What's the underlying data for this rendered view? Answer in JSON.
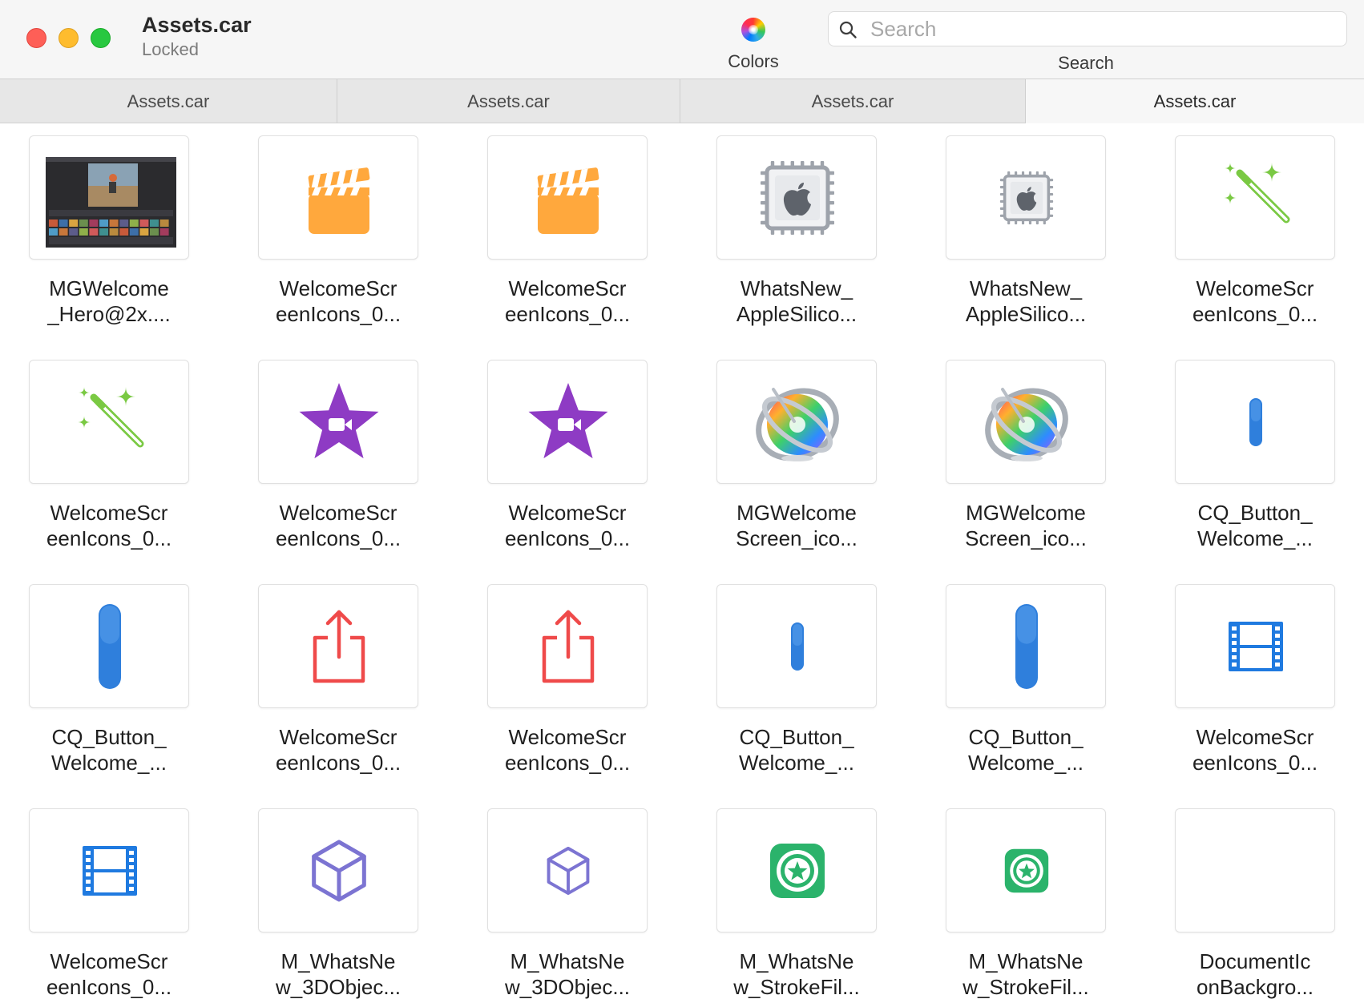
{
  "window": {
    "title": "Assets.car",
    "subtitle": "Locked"
  },
  "toolbar": {
    "colors_label": "Colors",
    "search_placeholder": "Search",
    "search_label": "Search"
  },
  "tabs": [
    {
      "label": "Assets.car",
      "active": false
    },
    {
      "label": "Assets.car",
      "active": false
    },
    {
      "label": "Assets.car",
      "active": false
    },
    {
      "label": "Assets.car",
      "active": true
    }
  ],
  "assets": [
    {
      "line1": "MGWelcome",
      "line2": "_Hero@2x....",
      "icon": "hero-screenshot-icon"
    },
    {
      "line1": "WelcomeScr",
      "line2": "eenIcons_0...",
      "icon": "clapperboard-icon"
    },
    {
      "line1": "WelcomeScr",
      "line2": "eenIcons_0...",
      "icon": "clapperboard-icon"
    },
    {
      "line1": "WhatsNew_",
      "line2": "AppleSilico...",
      "icon": "apple-silicon-chip-icon"
    },
    {
      "line1": "WhatsNew_",
      "line2": "AppleSilico...",
      "icon": "apple-silicon-chip-small-icon"
    },
    {
      "line1": "WelcomeScr",
      "line2": "eenIcons_0...",
      "icon": "magic-wand-icon"
    },
    {
      "line1": "WelcomeScr",
      "line2": "eenIcons_0...",
      "icon": "magic-wand-icon"
    },
    {
      "line1": "WelcomeScr",
      "line2": "eenIcons_0...",
      "icon": "imovie-star-icon"
    },
    {
      "line1": "WelcomeScr",
      "line2": "eenIcons_0...",
      "icon": "imovie-star-icon"
    },
    {
      "line1": "MGWelcome",
      "line2": "Screen_ico...",
      "icon": "motion-color-wheel-icon"
    },
    {
      "line1": "MGWelcome",
      "line2": "Screen_ico...",
      "icon": "motion-color-wheel-icon"
    },
    {
      "line1": "CQ_Button_",
      "line2": "Welcome_...",
      "icon": "blue-button-small-icon"
    },
    {
      "line1": "CQ_Button_",
      "line2": "Welcome_...",
      "icon": "blue-button-tall-icon"
    },
    {
      "line1": "WelcomeScr",
      "line2": "eenIcons_0...",
      "icon": "share-icon"
    },
    {
      "line1": "WelcomeScr",
      "line2": "eenIcons_0...",
      "icon": "share-icon"
    },
    {
      "line1": "CQ_Button_",
      "line2": "Welcome_...",
      "icon": "blue-button-small-icon"
    },
    {
      "line1": "CQ_Button_",
      "line2": "Welcome_...",
      "icon": "blue-button-tall-icon"
    },
    {
      "line1": "WelcomeScr",
      "line2": "eenIcons_0...",
      "icon": "film-strip-icon"
    },
    {
      "line1": "WelcomeScr",
      "line2": "eenIcons_0...",
      "icon": "film-strip-icon"
    },
    {
      "line1": "M_WhatsNe",
      "line2": "w_3DObjec...",
      "icon": "3d-cube-icon"
    },
    {
      "line1": "M_WhatsNe",
      "line2": "w_3DObjec...",
      "icon": "3d-cube-small-icon"
    },
    {
      "line1": "M_WhatsNe",
      "line2": "w_StrokeFil...",
      "icon": "stroke-filter-star-icon"
    },
    {
      "line1": "M_WhatsNe",
      "line2": "w_StrokeFil...",
      "icon": "stroke-filter-star-small-icon"
    },
    {
      "line1": "DocumentIc",
      "line2": "onBackgro...",
      "icon": "blank-document-icon"
    }
  ],
  "colors": {
    "clapper": "#ffa83d",
    "chip": "#9ea3ab",
    "wand": "#7ac943",
    "star": "#8e3bc4",
    "button_blue": "#2f7fdc",
    "share_red": "#ef4a4a",
    "film_blue": "#1f7ae0",
    "cube_purple": "#7c74d2",
    "stroke_green": "#2bb36b"
  }
}
